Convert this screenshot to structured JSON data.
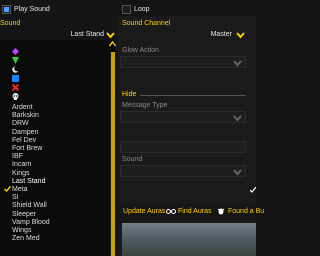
{
  "top_row": {
    "play_sound_label": "Play Sound",
    "loop_label": "Loop",
    "play_sound_checked": true,
    "loop_checked": false
  },
  "sound": {
    "label": "Sound",
    "value": "Last Stand"
  },
  "sound_channel": {
    "label": "Sound Channel",
    "value": "Master"
  },
  "glow_action": {
    "label": "Glow Action",
    "value": ""
  },
  "hide_section_label": "Hide",
  "message_type": {
    "label": "Message Type",
    "value": ""
  },
  "sound2": {
    "label": "Sound",
    "value": ""
  },
  "dropdown_icons": [
    "purple-diamond-icon",
    "green-triangle-icon",
    "moon-icon",
    "blue-square-icon",
    "red-cross-icon",
    "skull-icon"
  ],
  "dropdown_items": [
    "Ardent",
    "Barkskin",
    "DRW",
    "Dampen",
    "Fel Dev",
    "Fort Brew",
    "IBF",
    "Incarn",
    "Kings",
    "Last Stand",
    "Meta",
    "SI",
    "Shield Wall",
    "Sleeper",
    "Vamp Blood",
    "Wings",
    "Zen Med"
  ],
  "selected_item": "Last Stand",
  "tabs": {
    "update_auras": "Update Auras",
    "find_auras": "Find Auras",
    "found_a_bug": "Found a Bu"
  },
  "colors": {
    "accent_yellow": "#ffd100",
    "check_blue": "#4da3ff"
  }
}
